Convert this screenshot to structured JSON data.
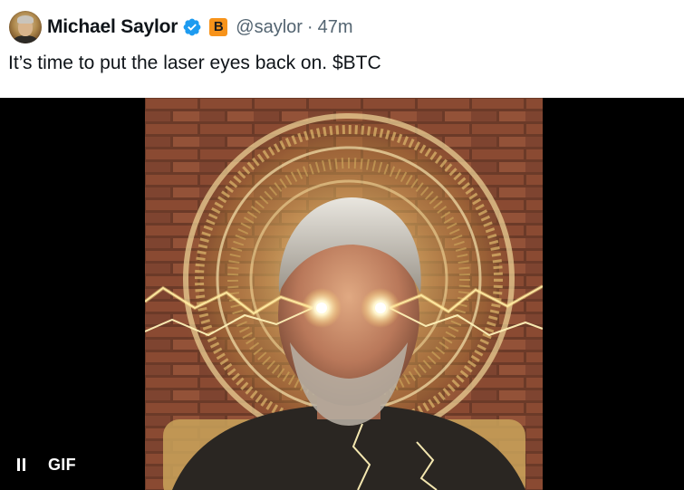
{
  "author": {
    "name": "Michael Saylor",
    "handle": "@saylor",
    "separator": "·",
    "time_ago": "47m",
    "verified_icon": "verified-check-icon",
    "affiliate_badge": "bitcoin-badge-icon",
    "affiliate_glyph": "B"
  },
  "tweet": {
    "text": "It’s time to put the laser eyes back on. $BTC"
  },
  "media": {
    "type": "gif",
    "gif_label": "GIF",
    "pause_icon": "pause-icon"
  },
  "colors": {
    "name": "#0f1419",
    "secondary": "#536471",
    "verified": "#1d9bf0",
    "bitcoin": "#f7931a",
    "media_bg": "#000000"
  }
}
